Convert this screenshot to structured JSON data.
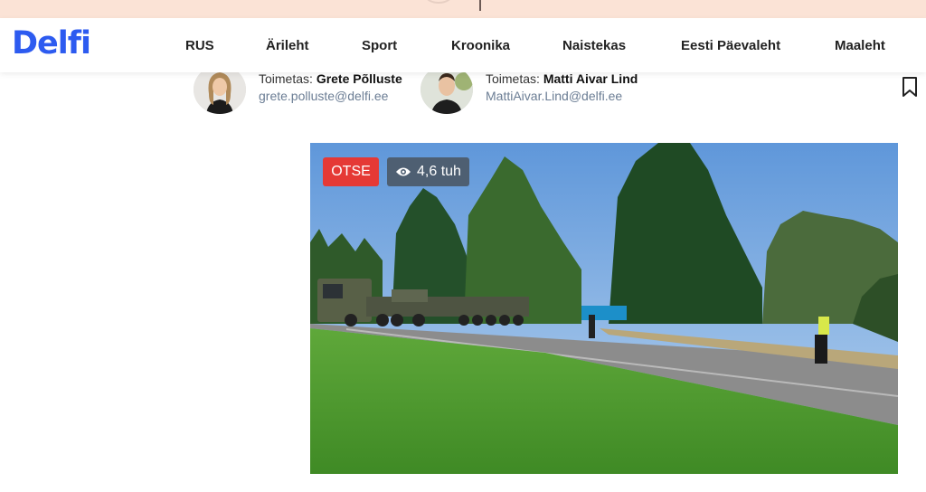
{
  "site": {
    "logo": "Delfi",
    "brand_color": "#2d5bf0"
  },
  "nav": {
    "items": [
      {
        "label": "RUS"
      },
      {
        "label": "Ärileht"
      },
      {
        "label": "Sport"
      },
      {
        "label": "Kroonika"
      },
      {
        "label": "Naistekas"
      },
      {
        "label": "Eesti Päevaleht"
      },
      {
        "label": "Maaleht"
      }
    ]
  },
  "authors": [
    {
      "role": "Toimetas:",
      "name": "Grete Põlluste",
      "email": "grete.polluste@delfi.ee"
    },
    {
      "role": "Toimetas:",
      "name": "Matti Aivar Lind",
      "email": "MattiAivar.Lind@delfi.ee"
    }
  ],
  "video": {
    "live_label": "OTSE",
    "views": "4,6 tuh",
    "live_color": "#e53935",
    "views_color": "#4e5f72"
  },
  "icons": {
    "bookmark": "bookmark-icon",
    "views": "eye-icon"
  }
}
